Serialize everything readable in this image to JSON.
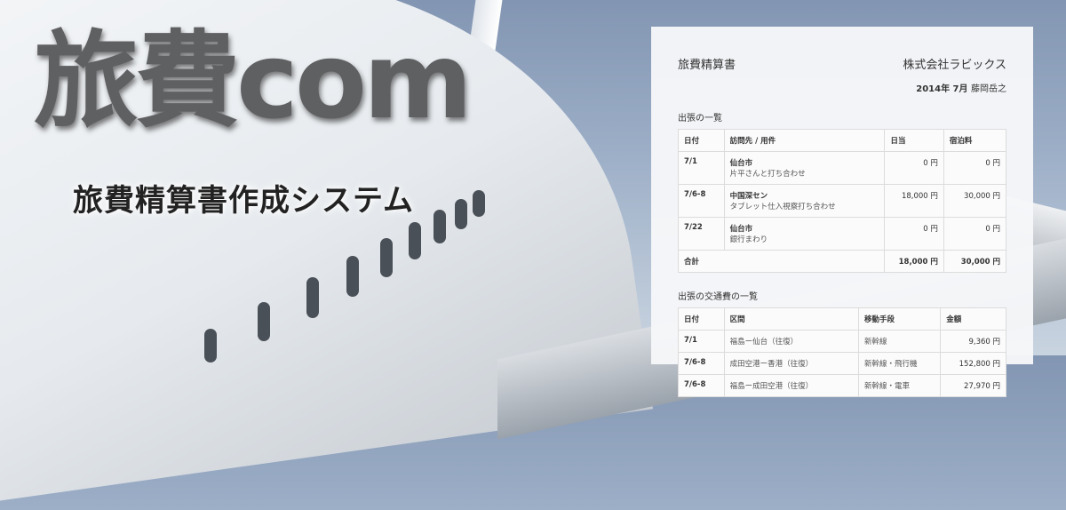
{
  "banner": {
    "title": "旅費com",
    "subtitle": "旅費精算書作成システム"
  },
  "document": {
    "title": "旅費精算書",
    "company": "株式会社ラビックス",
    "period": "2014年 7月",
    "person": "藤岡岳之",
    "trips": {
      "heading": "出張の一覧",
      "headers": [
        "日付",
        "訪問先 / 用件",
        "日当",
        "宿泊料"
      ],
      "rows": [
        {
          "date": "7/1",
          "place": "仙台市",
          "purpose": "片平さんと打ち合わせ",
          "allowance": "0 円",
          "lodging": "0 円"
        },
        {
          "date": "7/6-8",
          "place": "中国深セン",
          "purpose": "タブレット仕入視察打ち合わせ",
          "allowance": "18,000 円",
          "lodging": "30,000 円"
        },
        {
          "date": "7/22",
          "place": "仙台市",
          "purpose": "銀行まわり",
          "allowance": "0 円",
          "lodging": "0 円"
        }
      ],
      "total": {
        "label": "合計",
        "allowance": "18,000 円",
        "lodging": "30,000 円"
      }
    },
    "transport": {
      "heading": "出張の交通費の一覧",
      "headers": [
        "日付",
        "区間",
        "移動手段",
        "金額"
      ],
      "rows": [
        {
          "date": "7/1",
          "route": "福島ー仙台（往復）",
          "means": "新幹線",
          "amount": "9,360 円"
        },
        {
          "date": "7/6-8",
          "route": "成田空港ー香港（往復）",
          "means": "新幹線・飛行機",
          "amount": "152,800 円"
        },
        {
          "date": "7/6-8",
          "route": "福島ー成田空港（往復）",
          "means": "新幹線・電車",
          "amount": "27,970 円"
        }
      ]
    }
  }
}
